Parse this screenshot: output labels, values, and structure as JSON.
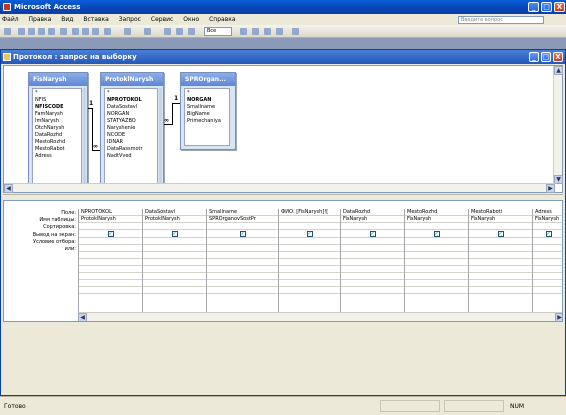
{
  "app": {
    "title": "Microsoft Access",
    "window_controls": [
      "_",
      "□",
      "X"
    ]
  },
  "menu": {
    "items": [
      "Файл",
      "Правка",
      "Вид",
      "Вставка",
      "Запрос",
      "Сервис",
      "Окно",
      "Справка"
    ],
    "ask_placeholder": "Введите вопрос"
  },
  "toolbar": {
    "view_select_value": "Все"
  },
  "child_window": {
    "title": "Протокол : запрос на выборку"
  },
  "tables": [
    {
      "name": "FisNarysh",
      "fields": [
        "*",
        "NFIS",
        "NFISCODE",
        "FamNarysh",
        "ImNarysh",
        "OtchNarysh",
        "DataRozhd",
        "MestoRozhd",
        "MestoRabot",
        "Adress"
      ],
      "key_fields": [
        "NFISCODE"
      ]
    },
    {
      "name": "ProtoklNarysh",
      "fields": [
        "*",
        "NPROTOKOL",
        "DataSostavl",
        "NORGAN",
        "STATYAZBO",
        "Narysheniе",
        "NCODE",
        "IDNAR",
        "DataRassmotr",
        "NadtVved"
      ],
      "key_fields": [
        "NPROTOKOL"
      ]
    },
    {
      "name": "SPROrgan...",
      "fields": [
        "*",
        "NORGAN",
        "Smallname",
        "BigName",
        "Primechaniya"
      ],
      "key_fields": [
        "NORGAN"
      ]
    }
  ],
  "relations": [
    {
      "one": "1",
      "many": "∞"
    },
    {
      "one": "1",
      "many": "∞"
    }
  ],
  "grid": {
    "row_labels": [
      "Поле:",
      "Имя таблицы:",
      "Сортировка:",
      "Вывод на экран:",
      "Условие отбора:",
      "или:"
    ],
    "columns": [
      {
        "field": "NPROTOKOL",
        "table": "ProtoklNarysh",
        "show": true
      },
      {
        "field": "DataSostavl",
        "table": "ProtoklNarysh",
        "show": true
      },
      {
        "field": "Smallname",
        "table": "SPROrganovSostPr",
        "show": true
      },
      {
        "field": "ФИО: [FisNarysh]![",
        "table": "",
        "show": true
      },
      {
        "field": "DataRozhd",
        "table": "FisNarysh",
        "show": true
      },
      {
        "field": "MestoRozhd",
        "table": "FisNarysh",
        "show": true
      },
      {
        "field": "MestoRaboti",
        "table": "FisNarysh",
        "show": true
      },
      {
        "field": "Adress",
        "table": "FisNarysh",
        "show": true
      }
    ],
    "check_mark": "✓"
  },
  "status": {
    "left": "Готово",
    "num": "NUM"
  }
}
